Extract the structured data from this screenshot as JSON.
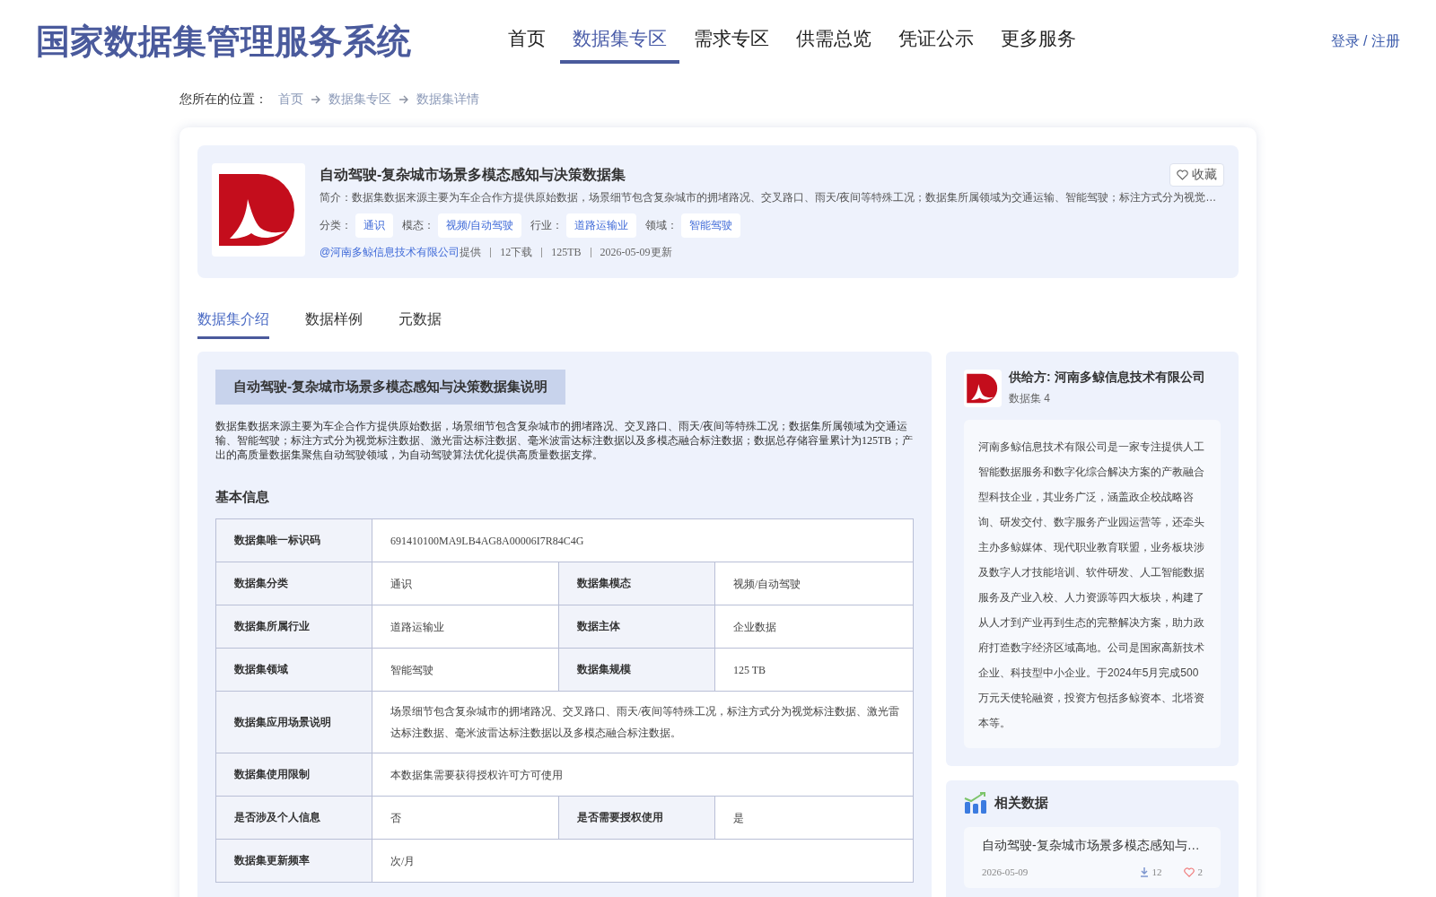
{
  "site": {
    "title": "国家数据集管理服务系统",
    "login": "登录 / 注册"
  },
  "nav": [
    {
      "label": "首页",
      "selected": false
    },
    {
      "label": "数据集专区",
      "selected": true
    },
    {
      "label": "需求专区",
      "selected": false
    },
    {
      "label": "供需总览",
      "selected": false
    },
    {
      "label": "凭证公示",
      "selected": false
    },
    {
      "label": "更多服务",
      "selected": false
    }
  ],
  "breadcrumb": {
    "label": "您所在的位置：",
    "items": [
      "首页",
      "数据集专区",
      "数据集详情"
    ]
  },
  "dataset": {
    "title": "自动驾驶-复杂城市场景多模态感知与决策数据集",
    "favorite": "收藏",
    "summary": "简介：数据集数据来源主要为车企合作方提供原始数据，场景细节包含复杂城市的拥堵路况、交叉路口、雨天/夜间等特殊工况；数据集所属领域为交通运输、智能驾驶；标注方式分为视觉…",
    "tags": [
      {
        "label": "分类：",
        "value": "通识"
      },
      {
        "label": "模态：",
        "value": "视频/自动驾驶"
      },
      {
        "label": "行业：",
        "value": "道路运输业"
      },
      {
        "label": "领域：",
        "value": "智能驾驶"
      }
    ],
    "provider": "@河南多鲸信息技术有限公司",
    "provider_suffix": "提供",
    "stats": [
      "12下载",
      "125TB",
      "2026-05-09更新"
    ]
  },
  "tabs": [
    {
      "label": "数据集介绍",
      "selected": true
    },
    {
      "label": "数据样例",
      "selected": false
    },
    {
      "label": "元数据",
      "selected": false
    }
  ],
  "intro": {
    "heading": "自动驾驶-复杂城市场景多模态感知与决策数据集说明",
    "text": "数据集数据来源主要为车企合作方提供原始数据，场景细节包含复杂城市的拥堵路况、交叉路口、雨天/夜间等特殊工况；数据集所属领域为交通运输、智能驾驶；标注方式分为视觉标注数据、激光雷达标注数据、毫米波雷达标注数据以及多模态融合标注数据；数据总存储容量累计为125TB；产出的高质量数据集聚焦自动驾驶领域，为自动驾驶算法优化提供高质量数据支撑。"
  },
  "basic_info": {
    "heading": "基本信息",
    "rows": [
      {
        "cells": [
          {
            "label": "数据集唯一标识码",
            "value": "691410100MA9LB4AG8A00006I7R84C4G"
          }
        ]
      },
      {
        "cells": [
          {
            "label": "数据集分类",
            "value": "通识"
          },
          {
            "label": "数据集模态",
            "value": "视频/自动驾驶"
          }
        ]
      },
      {
        "cells": [
          {
            "label": "数据集所属行业",
            "value": "道路运输业"
          },
          {
            "label": "数据主体",
            "value": "企业数据"
          }
        ]
      },
      {
        "cells": [
          {
            "label": "数据集领域",
            "value": "智能驾驶"
          },
          {
            "label": "数据集规模",
            "value": "125 TB"
          }
        ]
      },
      {
        "cells": [
          {
            "label": "数据集应用场景说明",
            "value": "场景细节包含复杂城市的拥堵路况、交叉路口、雨天/夜间等特殊工况，标注方式分为视觉标注数据、激光雷达标注数据、毫米波雷达标注数据以及多模态融合标注数据。"
          }
        ]
      },
      {
        "cells": [
          {
            "label": "数据集使用限制",
            "value": "本数据集需要获得授权许可方可使用"
          }
        ]
      },
      {
        "cells": [
          {
            "label": "是否涉及个人信息",
            "value": "否"
          },
          {
            "label": "是否需要授权使用",
            "value": "是"
          }
        ]
      },
      {
        "cells": [
          {
            "label": "数据集更新频率",
            "value": "次/月"
          }
        ]
      }
    ]
  },
  "supplier": {
    "name": "供给方: 河南多鲸信息技术有限公司",
    "count": "数据集 4",
    "description": "河南多鲸信息技术有限公司是一家专注提供人工智能数据服务和数字化综合解决方案的产教融合型科技企业，其业务广泛，涵盖政企校战略咨询、研发交付、数字服务产业园运营等，还牵头主办多鲸媒体、现代职业教育联盟，业务板块涉及数字人才技能培训、软件研发、人工智能数据服务及产业入校、人力资源等四大板块，构建了从人才到产业再到生态的完整解决方案，助力政府打造数字经济区域高地。公司是国家高新技术企业、科技型中小企业。于2024年5月完成500万元天使轮融资，投资方包括多鲸资本、北塔资本等。"
  },
  "related": {
    "heading": "相关数据",
    "items": [
      {
        "title": "自动驾驶-复杂城市场景多模态感知与…",
        "date": "2026-05-09",
        "downloads": "12",
        "likes": "2"
      }
    ]
  }
}
